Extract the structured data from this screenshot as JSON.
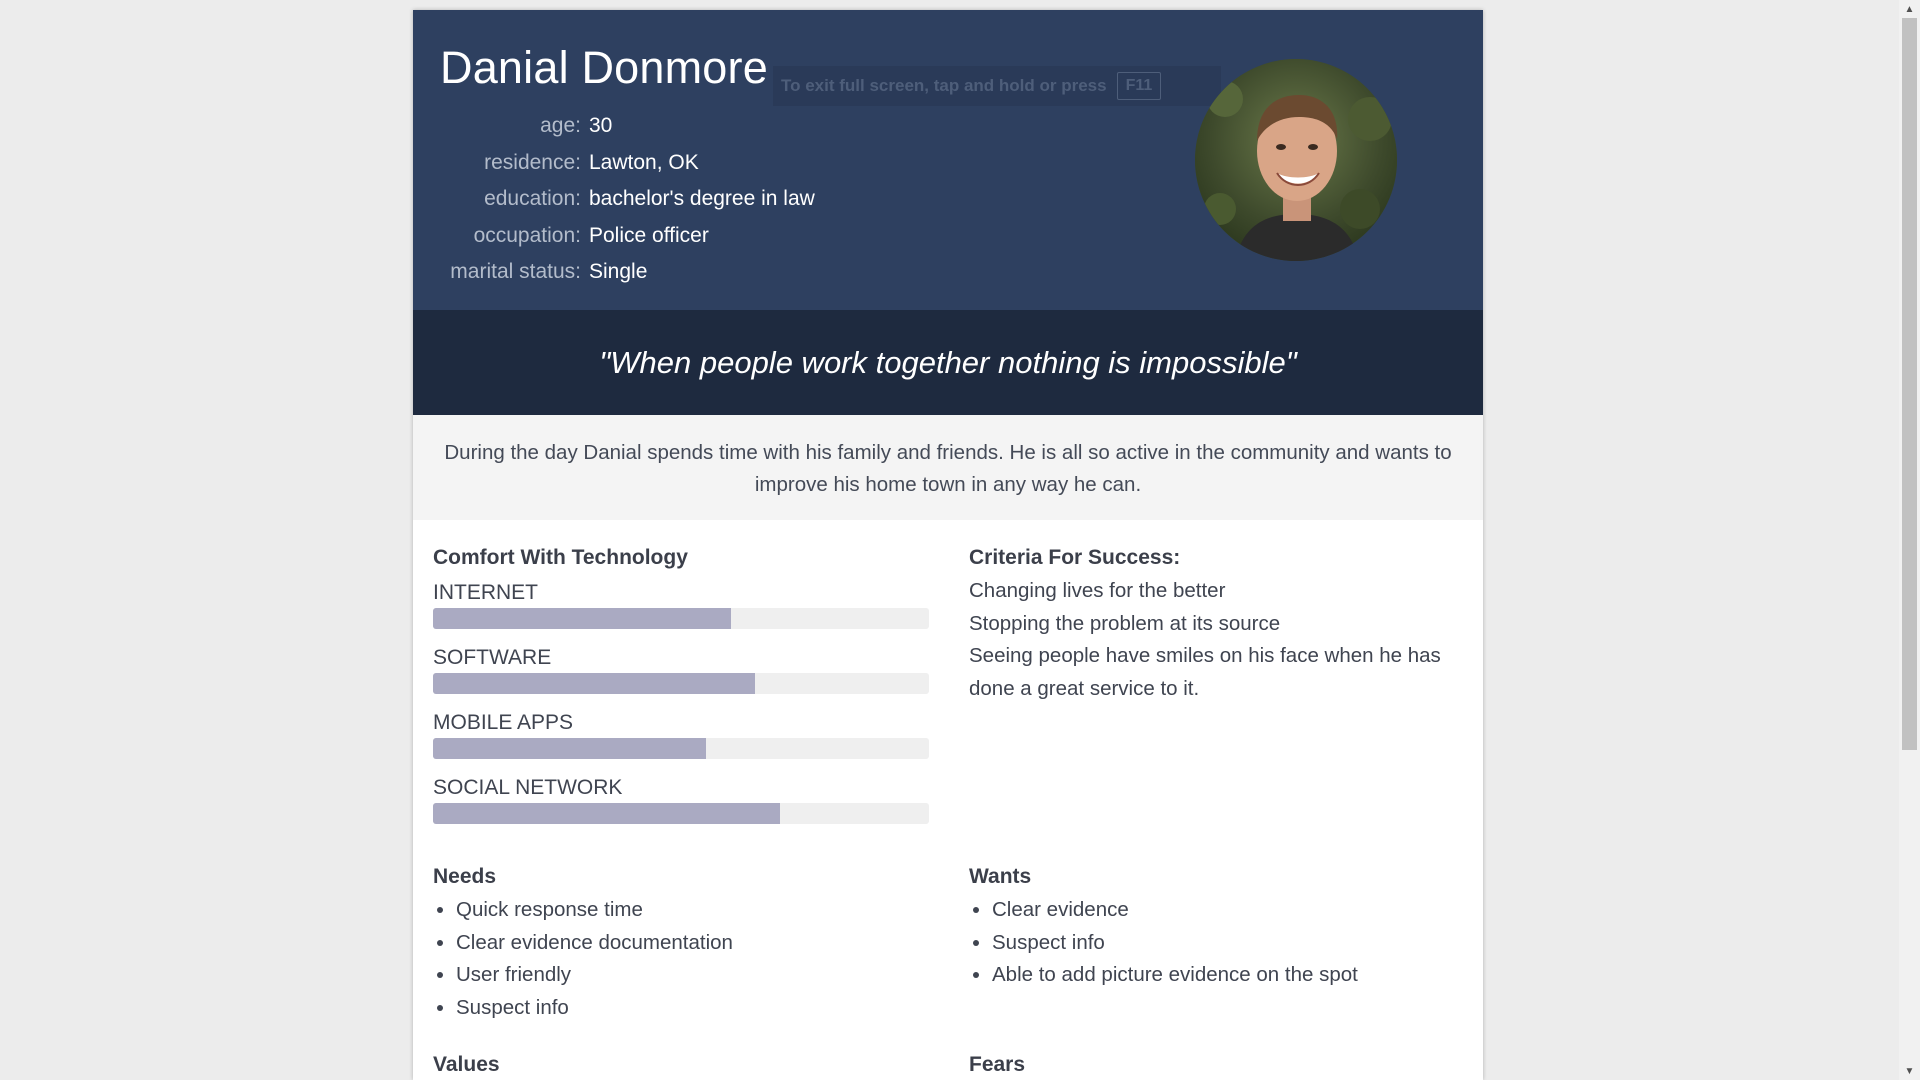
{
  "persona": {
    "name": "Danial Donmore",
    "fullscreen_notice": "To exit full screen, tap and hold or press",
    "fullscreen_key": "F11",
    "details": [
      {
        "label": "age:",
        "value": "30"
      },
      {
        "label": "residence:",
        "value": "Lawton, OK"
      },
      {
        "label": "education:",
        "value": "bachelor's degree in law"
      },
      {
        "label": "occupation:",
        "value": "Police officer"
      },
      {
        "label": "marital status:",
        "value": "Single"
      }
    ],
    "avatar_icon": "person-photo",
    "quote": "\"When people work together nothing is impossible\"",
    "summary": "During the day Danial spends time with his family and friends. He is all so active in the community and wants to improve his home town in any way he can."
  },
  "technology": {
    "title": "Comfort With Technology",
    "items": [
      {
        "label": "INTERNET",
        "level": 0.6
      },
      {
        "label": "SOFTWARE",
        "level": 0.65
      },
      {
        "label": "MOBILE APPS",
        "level": 0.55
      },
      {
        "label": "SOCIAL NETWORK",
        "level": 0.7
      }
    ],
    "bar_color": "#aaaac2",
    "track_color": "#efefef"
  },
  "criteria": {
    "title": "Criteria For Success:",
    "lines": [
      "Changing lives for the better",
      "Stopping the problem at its source",
      "Seeing people have smiles on his face when he has",
      "done a great service to it."
    ]
  },
  "needs": {
    "title": "Needs",
    "items": [
      "Quick response time",
      "Clear evidence documentation",
      "User friendly",
      "Suspect info"
    ]
  },
  "wants": {
    "title": "Wants",
    "items": [
      "Clear evidence",
      "Suspect info",
      "Able to add picture evidence on the spot"
    ]
  },
  "values": {
    "title": "Values"
  },
  "fears": {
    "title": "Fears"
  },
  "colors": {
    "header_bg": "#2e4060",
    "quote_bg": "#1e2a3f",
    "summary_bg": "#f4f4f4"
  }
}
